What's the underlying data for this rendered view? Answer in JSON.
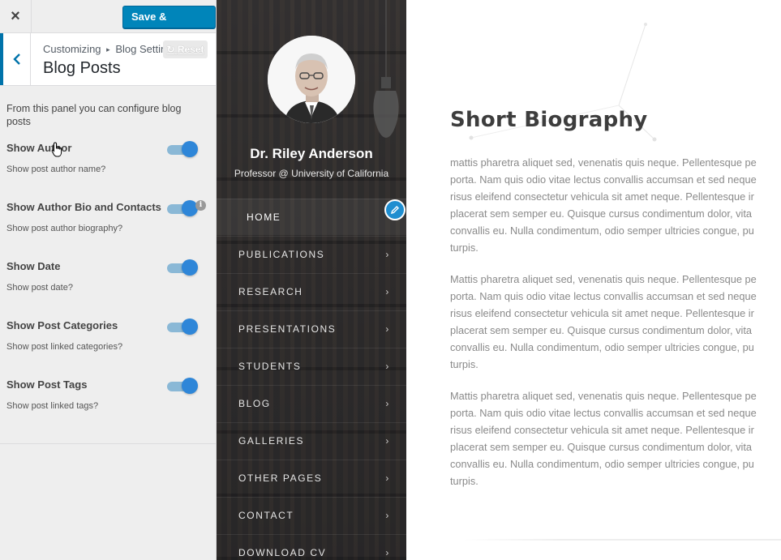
{
  "customizer": {
    "close_label": "×",
    "save_label": "Save & Publish",
    "breadcrumb": {
      "parent": "Customizing",
      "separator": "▸",
      "section": "Blog Settings"
    },
    "title": "Blog Posts",
    "reset_label": "Reset",
    "description": "From this panel you can configure blog posts",
    "controls": [
      {
        "label": "Show Author",
        "description": "Show post author name?",
        "enabled": true
      },
      {
        "label": "Show Author Bio and Contacts",
        "description": "Show post author biography?",
        "enabled": true,
        "info": "i"
      },
      {
        "label": "Show Date",
        "description": "Show post date?",
        "enabled": true
      },
      {
        "label": "Show Post Categories",
        "description": "Show post linked categories?",
        "enabled": true
      },
      {
        "label": "Show Post Tags",
        "description": "Show post linked tags?",
        "enabled": true
      }
    ],
    "accent_color": "#0085ba",
    "toggle_color": "#2e86d8"
  },
  "sidebar": {
    "name": "Dr. Riley Anderson",
    "role": "Professor @ University of California",
    "nav": [
      {
        "label": "HOME",
        "active": true
      },
      {
        "label": "PUBLICATIONS"
      },
      {
        "label": "RESEARCH"
      },
      {
        "label": "PRESENTATIONS"
      },
      {
        "label": "STUDENTS"
      },
      {
        "label": "BLOG"
      },
      {
        "label": "GALLERIES"
      },
      {
        "label": "OTHER PAGES"
      },
      {
        "label": "CONTACT"
      },
      {
        "label": "DOWNLOAD CV"
      }
    ],
    "chevron": "›"
  },
  "main": {
    "title": "Short Biography",
    "paragraphs": [
      [
        "mattis pharetra aliquet sed, venenatis quis neque. Pellentesque pe",
        "porta. Nam quis odio vitae lectus convallis accumsan et sed neque",
        "risus eleifend consectetur vehicula sit amet neque. Pellentesque ir",
        "placerat sem semper eu. Quisque cursus condimentum dolor, vita",
        "convallis eu. Nulla condimentum, odio semper ultricies congue, pu",
        "turpis."
      ],
      [
        "Mattis pharetra aliquet sed, venenatis quis neque. Pellentesque pe",
        "porta. Nam quis odio vitae lectus convallis accumsan et sed neque",
        "risus eleifend consectetur vehicula sit amet neque. Pellentesque ir",
        "placerat sem semper eu. Quisque cursus condimentum dolor, vita",
        "convallis eu. Nulla condimentum, odio semper ultricies congue, pu",
        "turpis."
      ],
      [
        "Mattis pharetra aliquet sed, venenatis quis neque. Pellentesque pe",
        "porta. Nam quis odio vitae lectus convallis accumsan et sed neque",
        "risus eleifend consectetur vehicula sit amet neque. Pellentesque ir",
        "placerat sem semper eu. Quisque cursus condimentum dolor, vita",
        "convallis eu. Nulla condimentum, odio semper ultricies congue, pu",
        "turpis."
      ]
    ]
  }
}
